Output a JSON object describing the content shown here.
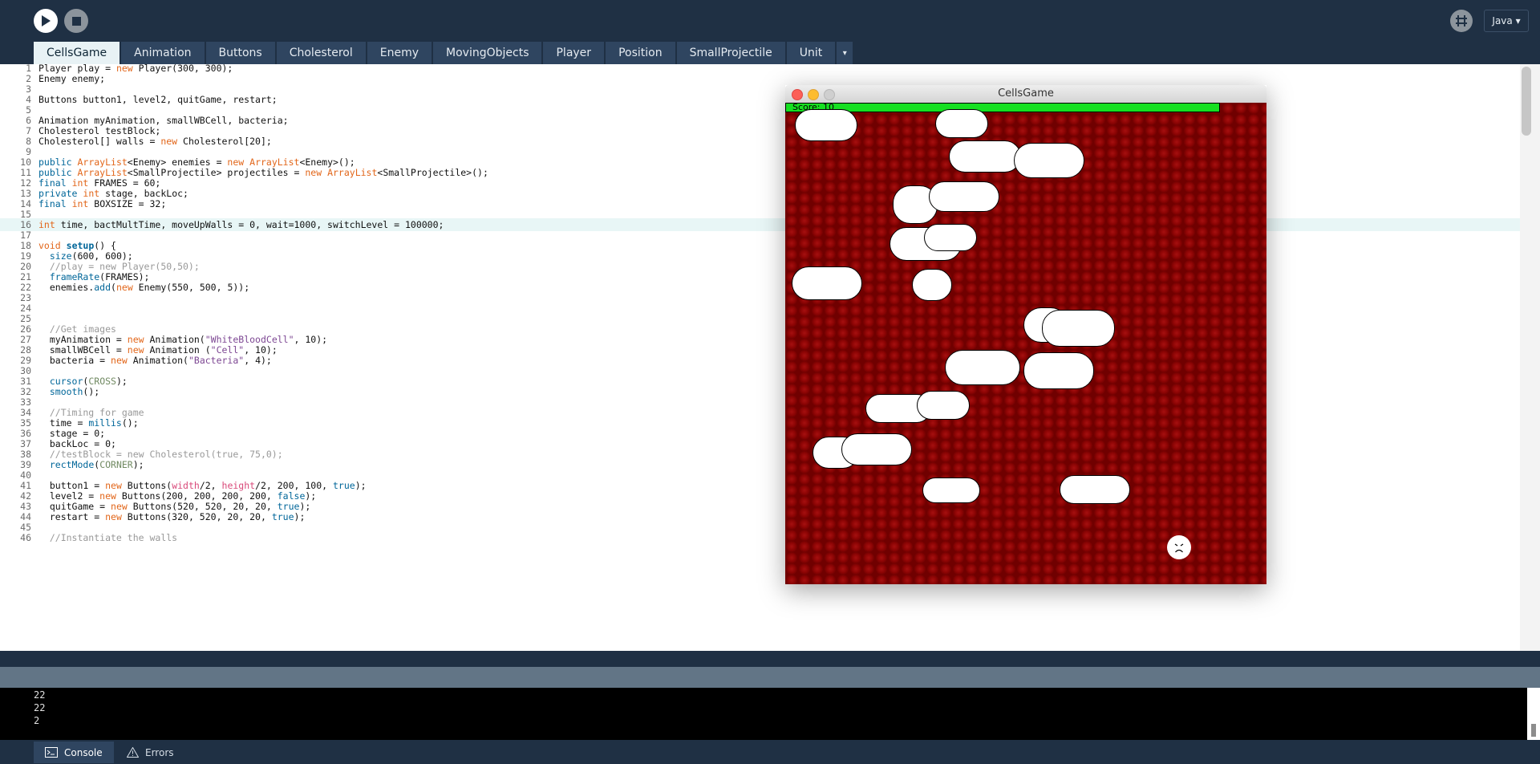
{
  "toolbar": {
    "run_icon": "play-icon",
    "stop_icon": "stop-icon",
    "mode_icon": "debug-mode-icon",
    "language": "Java ▾"
  },
  "tabs": [
    "CellsGame",
    "Animation",
    "Buttons",
    "Cholesterol",
    "Enemy",
    "MovingObjects",
    "Player",
    "Position",
    "SmallProjectile",
    "Unit"
  ],
  "tabs_more": "▾",
  "editor": {
    "highlighted_line": 16,
    "lines": [
      {
        "n": "1",
        "t": [
          {
            "s": "Player play = "
          },
          {
            "s": "new",
            "c": "k"
          },
          {
            "s": " Player(300, 300);"
          }
        ]
      },
      {
        "n": "2",
        "t": [
          {
            "s": "Enemy enemy;"
          }
        ]
      },
      {
        "n": "3",
        "t": []
      },
      {
        "n": "4",
        "t": [
          {
            "s": "Buttons button1, level2, quitGame, restart;"
          }
        ]
      },
      {
        "n": "5",
        "t": []
      },
      {
        "n": "6",
        "t": [
          {
            "s": "Animation myAnimation, smallWBCell, bacteria;"
          }
        ]
      },
      {
        "n": "7",
        "t": [
          {
            "s": "Cholesterol testBlock;"
          }
        ]
      },
      {
        "n": "8",
        "t": [
          {
            "s": "Cholesterol[] walls = "
          },
          {
            "s": "new",
            "c": "k"
          },
          {
            "s": " Cholesterol[20];"
          }
        ]
      },
      {
        "n": "9",
        "t": []
      },
      {
        "n": "10",
        "t": [
          {
            "s": "public",
            "c": "f"
          },
          {
            "s": " "
          },
          {
            "s": "ArrayList",
            "c": "k"
          },
          {
            "s": "<Enemy> enemies = "
          },
          {
            "s": "new",
            "c": "k"
          },
          {
            "s": " "
          },
          {
            "s": "ArrayList",
            "c": "k"
          },
          {
            "s": "<Enemy>();"
          }
        ]
      },
      {
        "n": "11",
        "t": [
          {
            "s": "public",
            "c": "f"
          },
          {
            "s": " "
          },
          {
            "s": "ArrayList",
            "c": "k"
          },
          {
            "s": "<SmallProjectile> projectiles = "
          },
          {
            "s": "new",
            "c": "k"
          },
          {
            "s": " "
          },
          {
            "s": "ArrayList",
            "c": "k"
          },
          {
            "s": "<SmallProjectile>();"
          }
        ]
      },
      {
        "n": "12",
        "t": [
          {
            "s": "final",
            "c": "f"
          },
          {
            "s": " "
          },
          {
            "s": "int",
            "c": "k"
          },
          {
            "s": " FRAMES = 60;"
          }
        ]
      },
      {
        "n": "13",
        "t": [
          {
            "s": "private",
            "c": "f"
          },
          {
            "s": " "
          },
          {
            "s": "int",
            "c": "k"
          },
          {
            "s": " stage, backLoc;"
          }
        ]
      },
      {
        "n": "14",
        "t": [
          {
            "s": "final",
            "c": "f"
          },
          {
            "s": " "
          },
          {
            "s": "int",
            "c": "k"
          },
          {
            "s": " BOXSIZE = 32;"
          }
        ]
      },
      {
        "n": "15",
        "t": []
      },
      {
        "n": "16",
        "t": [
          {
            "s": "int",
            "c": "k"
          },
          {
            "s": " time, bactMultTime, moveUpWalls = 0, wait=1000, switchLevel = 100000;"
          }
        ]
      },
      {
        "n": "17",
        "t": []
      },
      {
        "n": "18",
        "t": [
          {
            "s": "void",
            "c": "k"
          },
          {
            "s": " "
          },
          {
            "s": "setup",
            "c": "fb"
          },
          {
            "s": "() {"
          }
        ]
      },
      {
        "n": "19",
        "t": [
          {
            "s": "  "
          },
          {
            "s": "size",
            "c": "f"
          },
          {
            "s": "(600, 600);"
          }
        ]
      },
      {
        "n": "20",
        "t": [
          {
            "s": "  //play = new Player(50,50);",
            "c": "c"
          }
        ]
      },
      {
        "n": "21",
        "t": [
          {
            "s": "  "
          },
          {
            "s": "frameRate",
            "c": "f"
          },
          {
            "s": "(FRAMES);"
          }
        ]
      },
      {
        "n": "22",
        "t": [
          {
            "s": "  enemies."
          },
          {
            "s": "add",
            "c": "f"
          },
          {
            "s": "("
          },
          {
            "s": "new",
            "c": "k"
          },
          {
            "s": " Enemy(550, 500, 5));"
          }
        ]
      },
      {
        "n": "23",
        "t": []
      },
      {
        "n": "24",
        "t": []
      },
      {
        "n": "25",
        "t": []
      },
      {
        "n": "26",
        "t": [
          {
            "s": "  //Get images",
            "c": "c"
          }
        ]
      },
      {
        "n": "27",
        "t": [
          {
            "s": "  myAnimation = "
          },
          {
            "s": "new",
            "c": "k"
          },
          {
            "s": " Animation("
          },
          {
            "s": "\"WhiteBloodCell\"",
            "c": "s"
          },
          {
            "s": ", 10);"
          }
        ]
      },
      {
        "n": "28",
        "t": [
          {
            "s": "  smallWBCell = "
          },
          {
            "s": "new",
            "c": "k"
          },
          {
            "s": " Animation ("
          },
          {
            "s": "\"Cell\"",
            "c": "s"
          },
          {
            "s": ", 10);"
          }
        ]
      },
      {
        "n": "29",
        "t": [
          {
            "s": "  bacteria = "
          },
          {
            "s": "new",
            "c": "k"
          },
          {
            "s": " Animation("
          },
          {
            "s": "\"Bacteria\"",
            "c": "s"
          },
          {
            "s": ", 4);"
          }
        ]
      },
      {
        "n": "30",
        "t": []
      },
      {
        "n": "31",
        "t": [
          {
            "s": "  "
          },
          {
            "s": "cursor",
            "c": "f"
          },
          {
            "s": "("
          },
          {
            "s": "CROSS",
            "c": "v"
          },
          {
            "s": ");"
          }
        ]
      },
      {
        "n": "32",
        "t": [
          {
            "s": "  "
          },
          {
            "s": "smooth",
            "c": "f"
          },
          {
            "s": "();"
          }
        ]
      },
      {
        "n": "33",
        "t": []
      },
      {
        "n": "34",
        "t": [
          {
            "s": "  //Timing for game",
            "c": "c"
          }
        ]
      },
      {
        "n": "35",
        "t": [
          {
            "s": "  time = "
          },
          {
            "s": "millis",
            "c": "f"
          },
          {
            "s": "();"
          }
        ]
      },
      {
        "n": "36",
        "t": [
          {
            "s": "  stage = 0;"
          }
        ]
      },
      {
        "n": "37",
        "t": [
          {
            "s": "  backLoc = 0;"
          }
        ]
      },
      {
        "n": "38",
        "t": [
          {
            "s": "  //testBlock = new Cholesterol(true, 75,0);",
            "c": "c"
          }
        ]
      },
      {
        "n": "39",
        "t": [
          {
            "s": "  "
          },
          {
            "s": "rectMode",
            "c": "f"
          },
          {
            "s": "("
          },
          {
            "s": "CORNER",
            "c": "v"
          },
          {
            "s": ");"
          }
        ]
      },
      {
        "n": "40",
        "t": []
      },
      {
        "n": "41",
        "t": [
          {
            "s": "  button1 = "
          },
          {
            "s": "new",
            "c": "k"
          },
          {
            "s": " Buttons("
          },
          {
            "s": "width",
            "c": "p"
          },
          {
            "s": "/2, "
          },
          {
            "s": "height",
            "c": "p"
          },
          {
            "s": "/2, 200, 100, "
          },
          {
            "s": "true",
            "c": "f"
          },
          {
            "s": ");"
          }
        ]
      },
      {
        "n": "42",
        "t": [
          {
            "s": "  level2 = "
          },
          {
            "s": "new",
            "c": "k"
          },
          {
            "s": " Buttons(200, 200, 200, 200, "
          },
          {
            "s": "false",
            "c": "f"
          },
          {
            "s": ");"
          }
        ]
      },
      {
        "n": "43",
        "t": [
          {
            "s": "  quitGame = "
          },
          {
            "s": "new",
            "c": "k"
          },
          {
            "s": " Buttons(520, 520, 20, 20, "
          },
          {
            "s": "true",
            "c": "f"
          },
          {
            "s": ");"
          }
        ]
      },
      {
        "n": "44",
        "t": [
          {
            "s": "  restart = "
          },
          {
            "s": "new",
            "c": "k"
          },
          {
            "s": " Buttons(320, 520, 20, 20, "
          },
          {
            "s": "true",
            "c": "f"
          },
          {
            "s": ");"
          }
        ]
      },
      {
        "n": "45",
        "t": []
      },
      {
        "n": "46",
        "t": [
          {
            "s": "  //Instantiate the walls",
            "c": "c"
          }
        ]
      }
    ]
  },
  "console": {
    "lines": [
      "22",
      "22",
      "2"
    ]
  },
  "footer": {
    "console_label": "Console",
    "errors_label": "Errors"
  },
  "game_window": {
    "title": "CellsGame",
    "score": "Score: 10",
    "health_fraction": 0.9,
    "player_icon": "frown-face-icon"
  }
}
